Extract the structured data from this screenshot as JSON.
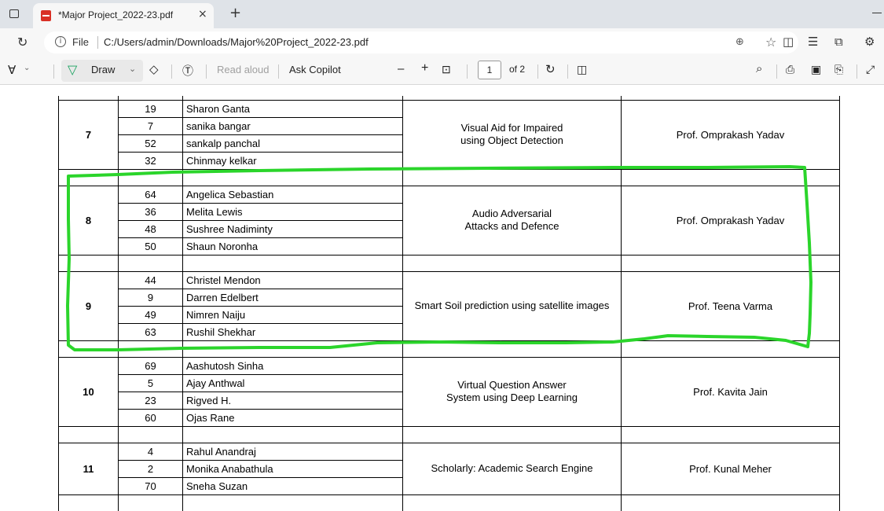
{
  "browser": {
    "tab_title": "*Major Project_2022-23.pdf",
    "tab_close": "×",
    "new_tab": "+",
    "url_label": "File",
    "url": "C:/Users/admin/Downloads/Major%20Project_2022-23.pdf"
  },
  "toolbar": {
    "draw_label": "Draw",
    "read_aloud": "Read aloud",
    "ask_copilot": "Ask Copilot",
    "zoom_out": "–",
    "zoom_in": "+",
    "page_number": "1",
    "page_total": "of 2"
  },
  "table": {
    "groups": [
      {
        "group": "7",
        "members": [
          {
            "roll": "19",
            "name": "Sharon Ganta"
          },
          {
            "roll": "7",
            "name": "sanika bangar"
          },
          {
            "roll": "52",
            "name": "sankalp panchal"
          },
          {
            "roll": "32",
            "name": "Chinmay kelkar"
          }
        ],
        "title_line1": "Visual Aid for Impaired",
        "title_line2": "using Object Detection",
        "guide": "Prof. Omprakash Yadav"
      },
      {
        "group": "8",
        "members": [
          {
            "roll": "64",
            "name": "Angelica Sebastian"
          },
          {
            "roll": "36",
            "name": "Melita Lewis"
          },
          {
            "roll": "48",
            "name": "Sushree Nadiminty"
          },
          {
            "roll": "50",
            "name": "Shaun Noronha"
          }
        ],
        "title_line1": "Audio Adversarial",
        "title_line2": "Attacks and Defence",
        "guide": "Prof. Omprakash Yadav"
      },
      {
        "group": "9",
        "members": [
          {
            "roll": "44",
            "name": "Christel Mendon"
          },
          {
            "roll": "9",
            "name": "Darren Edelbert"
          },
          {
            "roll": "49",
            "name": "Nimren Naiju"
          },
          {
            "roll": "63",
            "name": "Rushil Shekhar"
          }
        ],
        "title_line1": "Smart Soil prediction using satellite images",
        "title_line2": "",
        "guide": "Prof. Teena Varma"
      },
      {
        "group": "10",
        "members": [
          {
            "roll": "69",
            "name": "Aashutosh Sinha"
          },
          {
            "roll": "5",
            "name": "Ajay Anthwal"
          },
          {
            "roll": "23",
            "name": "Rigved H."
          },
          {
            "roll": "60",
            "name": "Ojas Rane"
          }
        ],
        "title_line1": "Virtual Question Answer",
        "title_line2": "System using Deep Learning",
        "guide": "Prof. Kavita Jain"
      },
      {
        "group": "11",
        "members": [
          {
            "roll": "4",
            "name": "Rahul Anandraj"
          },
          {
            "roll": "2",
            "name": "Monika Anabathula"
          },
          {
            "roll": "70",
            "name": "Sneha Suzan"
          }
        ],
        "title_line1": "Scholarly: Academic Search Engine",
        "title_line2": "",
        "guide": "Prof. Kunal Meher"
      }
    ]
  },
  "annotation": {
    "color": "#2bd52b",
    "icon": "freehand-rectangle"
  },
  "colors": {
    "titlebar": "#dfe3e8",
    "toolbar": "#f7f7f7",
    "draw_icon": "#1aa260"
  }
}
